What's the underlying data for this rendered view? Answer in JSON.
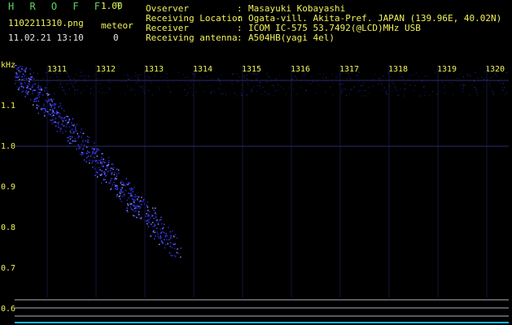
{
  "app": {
    "title": "H R O F F T",
    "version": "1.00",
    "filename": "1102211310.png",
    "meteor_label": "meteor",
    "datetime": "11.02.21 13:10",
    "meteor_count": "0"
  },
  "info": [
    {
      "label": "Ovserver",
      "sep": ":",
      "value": "Masayuki Kobayashi"
    },
    {
      "label": "Receiving Location",
      "sep": ":",
      "value": "Ogata-vill. Akita-Pref. JAPAN (139.96E, 40.02N)"
    },
    {
      "label": "Receiver",
      "sep": ":",
      "value": "ICOM IC-575 53.7492(@LCD)MHz USB"
    },
    {
      "label": "Receiving antenna",
      "sep": ":",
      "value": "A504HB(yagi 4el)"
    }
  ],
  "spectrogram": {
    "y_unit": "kHz",
    "x_ticks": [
      "1311",
      "1312",
      "1313",
      "1314",
      "1315",
      "1316",
      "1317",
      "1318",
      "1319",
      "1320"
    ],
    "y_ticks": [
      "1.1",
      "1.0",
      "0.9",
      "0.8",
      "0.7",
      "0.6"
    ],
    "colors": {
      "tick": "#f2f25a",
      "background": "#000000",
      "signal": "#3a3aff",
      "line": "#b0b0c0"
    }
  }
}
